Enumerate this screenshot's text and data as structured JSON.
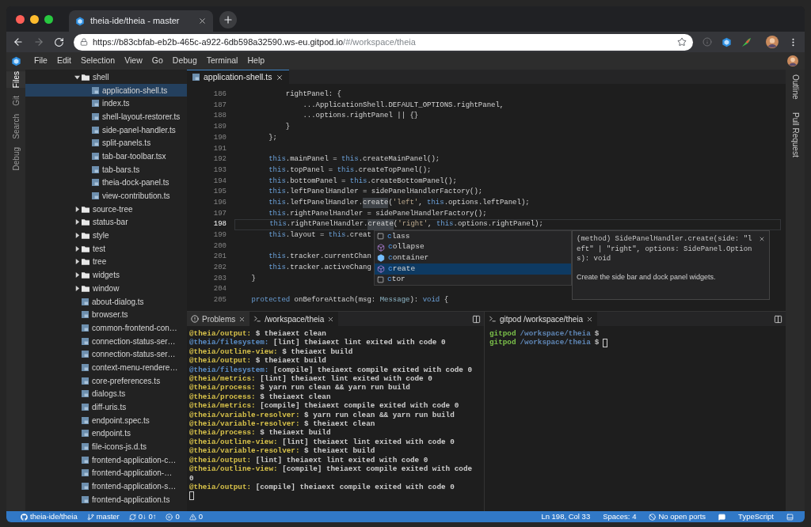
{
  "browser": {
    "tab_title": "theia-ide/theia - master",
    "url_host": "https://b83cbfab-eb2b-465c-a922-6db598a32590.ws-eu.gitpod.io",
    "url_path": "/#/workspace/theia"
  },
  "menu": [
    "File",
    "Edit",
    "Selection",
    "View",
    "Go",
    "Debug",
    "Terminal",
    "Help"
  ],
  "left_tabs": [
    {
      "label": "Files",
      "selected": true
    },
    {
      "label": "Git",
      "selected": false
    },
    {
      "label": "Search",
      "selected": false
    },
    {
      "label": "Debug",
      "selected": false
    }
  ],
  "right_tabs": [
    {
      "label": "Outline",
      "selected": false
    },
    {
      "label": "Pull Request",
      "selected": false
    }
  ],
  "file_tree": [
    {
      "name": "shell",
      "kind": "folder",
      "expanded": true,
      "selected": false,
      "children": [
        {
          "name": "application-shell.ts",
          "kind": "file",
          "selected": true
        },
        {
          "name": "index.ts",
          "kind": "file",
          "selected": false
        },
        {
          "name": "shell-layout-restorer.ts",
          "kind": "file",
          "selected": false
        },
        {
          "name": "side-panel-handler.ts",
          "kind": "file",
          "selected": false
        },
        {
          "name": "split-panels.ts",
          "kind": "file",
          "selected": false
        },
        {
          "name": "tab-bar-toolbar.tsx",
          "kind": "file",
          "selected": false
        },
        {
          "name": "tab-bars.ts",
          "kind": "file",
          "selected": false
        },
        {
          "name": "theia-dock-panel.ts",
          "kind": "file",
          "selected": false
        },
        {
          "name": "view-contribution.ts",
          "kind": "file",
          "selected": false
        }
      ]
    },
    {
      "name": "source-tree",
      "kind": "folder",
      "expanded": false,
      "selected": false
    },
    {
      "name": "status-bar",
      "kind": "folder",
      "expanded": false,
      "selected": false
    },
    {
      "name": "style",
      "kind": "folder",
      "expanded": false,
      "selected": false
    },
    {
      "name": "test",
      "kind": "folder",
      "expanded": false,
      "selected": false
    },
    {
      "name": "tree",
      "kind": "folder",
      "expanded": false,
      "selected": false
    },
    {
      "name": "widgets",
      "kind": "folder",
      "expanded": false,
      "selected": false
    },
    {
      "name": "window",
      "kind": "folder",
      "expanded": false,
      "selected": false
    },
    {
      "name": "about-dialog.ts",
      "kind": "file",
      "selected": false
    },
    {
      "name": "browser.ts",
      "kind": "file",
      "selected": false
    },
    {
      "name": "common-frontend-con…",
      "kind": "file",
      "selected": false
    },
    {
      "name": "connection-status-ser…",
      "kind": "file",
      "selected": false
    },
    {
      "name": "connection-status-ser…",
      "kind": "file",
      "selected": false
    },
    {
      "name": "context-menu-rendere…",
      "kind": "file",
      "selected": false
    },
    {
      "name": "core-preferences.ts",
      "kind": "file",
      "selected": false
    },
    {
      "name": "dialogs.ts",
      "kind": "file",
      "selected": false
    },
    {
      "name": "diff-uris.ts",
      "kind": "file",
      "selected": false
    },
    {
      "name": "endpoint.spec.ts",
      "kind": "file",
      "selected": false
    },
    {
      "name": "endpoint.ts",
      "kind": "file",
      "selected": false
    },
    {
      "name": "file-icons-js.d.ts",
      "kind": "file",
      "selected": false
    },
    {
      "name": "frontend-application-c…",
      "kind": "file",
      "selected": false
    },
    {
      "name": "frontend-application-…",
      "kind": "file",
      "selected": false
    },
    {
      "name": "frontend-application-s…",
      "kind": "file",
      "selected": false
    },
    {
      "name": "frontend-application.ts",
      "kind": "file",
      "selected": false
    }
  ],
  "editor": {
    "tabs": [
      {
        "label": "application-shell.ts",
        "selected": true
      }
    ],
    "lines": [
      {
        "number": "186",
        "current": false,
        "tokens": [
          {
            "text": "            rightPanel: {",
            "kind": "plain"
          }
        ]
      },
      {
        "number": "187",
        "current": false,
        "tokens": [
          {
            "text": "                ...ApplicationShell.DEFAULT_OPTIONS.rightPanel,",
            "kind": "plain"
          }
        ]
      },
      {
        "number": "188",
        "current": false,
        "tokens": [
          {
            "text": "                ...options.rightPanel || {}",
            "kind": "plain"
          }
        ]
      },
      {
        "number": "189",
        "current": false,
        "tokens": [
          {
            "text": "            }",
            "kind": "plain"
          }
        ]
      },
      {
        "number": "190",
        "current": false,
        "tokens": [
          {
            "text": "        };",
            "kind": "plain"
          }
        ]
      },
      {
        "number": "191",
        "current": false
      },
      {
        "number": "192",
        "current": false,
        "tokens": [
          {
            "text": "        this",
            "kind": "keyword"
          },
          {
            "text": ".mainPanel = ",
            "kind": "plain"
          },
          {
            "text": "this",
            "kind": "keyword"
          },
          {
            "text": ".createMainPanel();",
            "kind": "plain"
          }
        ]
      },
      {
        "number": "193",
        "current": false,
        "tokens": [
          {
            "text": "        this",
            "kind": "keyword"
          },
          {
            "text": ".topPanel = ",
            "kind": "plain"
          },
          {
            "text": "this",
            "kind": "keyword"
          },
          {
            "text": ".createTopPanel();",
            "kind": "plain"
          }
        ]
      },
      {
        "number": "194",
        "current": false,
        "tokens": [
          {
            "text": "        this",
            "kind": "keyword"
          },
          {
            "text": ".bottomPanel = ",
            "kind": "plain"
          },
          {
            "text": "this",
            "kind": "keyword"
          },
          {
            "text": ".createBottomPanel();",
            "kind": "plain"
          }
        ]
      },
      {
        "number": "195",
        "current": false,
        "tokens": [
          {
            "text": "        this",
            "kind": "keyword"
          },
          {
            "text": ".leftPanelHandler = sidePanelHandlerFactory();",
            "kind": "plain"
          }
        ]
      },
      {
        "number": "196",
        "current": false,
        "tokens": [
          {
            "text": "        this",
            "kind": "keyword"
          },
          {
            "text": ".leftPanelHandler.",
            "kind": "plain"
          },
          {
            "text": "create",
            "kind": "match"
          },
          {
            "text": "(",
            "kind": "plain"
          },
          {
            "text": "'left'",
            "kind": "string"
          },
          {
            "text": ", ",
            "kind": "plain"
          },
          {
            "text": "this",
            "kind": "keyword"
          },
          {
            "text": ".options.leftPanel);",
            "kind": "plain"
          }
        ]
      },
      {
        "number": "197",
        "current": false,
        "tokens": [
          {
            "text": "        this",
            "kind": "keyword"
          },
          {
            "text": ".rightPanelHandler = sidePanelHandlerFactory();",
            "kind": "plain"
          }
        ]
      },
      {
        "number": "198",
        "current": true,
        "tokens": [
          {
            "text": "        this",
            "kind": "keyword"
          },
          {
            "text": ".rightPanelHandler.",
            "kind": "plain"
          },
          {
            "text": "create",
            "kind": "match"
          },
          {
            "text": "(",
            "kind": "plain"
          },
          {
            "text": "'right'",
            "kind": "string"
          },
          {
            "text": ", ",
            "kind": "plain"
          },
          {
            "text": "this",
            "kind": "keyword"
          },
          {
            "text": ".options.rightPanel);",
            "kind": "plain"
          }
        ]
      },
      {
        "number": "199",
        "current": false,
        "tokens": [
          {
            "text": "        this",
            "kind": "keyword"
          },
          {
            "text": ".layout = ",
            "kind": "plain"
          },
          {
            "text": "this",
            "kind": "keyword"
          },
          {
            "text": ".creat",
            "kind": "plain"
          }
        ]
      },
      {
        "number": "200",
        "current": false
      },
      {
        "number": "201",
        "current": false,
        "tokens": [
          {
            "text": "        this",
            "kind": "keyword"
          },
          {
            "text": ".tracker.currentChan",
            "kind": "plain"
          }
        ]
      },
      {
        "number": "202",
        "current": false,
        "tokens": [
          {
            "text": "        this",
            "kind": "keyword"
          },
          {
            "text": ".tracker.activeChang",
            "kind": "plain"
          }
        ]
      },
      {
        "number": "203",
        "current": false,
        "tokens": [
          {
            "text": "    }",
            "kind": "plain"
          }
        ]
      },
      {
        "number": "204",
        "current": false
      },
      {
        "number": "205",
        "current": false,
        "tokens": [
          {
            "text": "    protected",
            "kind": "keyword"
          },
          {
            "text": " onBeforeAttach(msg: ",
            "kind": "plain"
          },
          {
            "text": "Message",
            "kind": "type"
          },
          {
            "text": "): ",
            "kind": "plain"
          },
          {
            "text": "void",
            "kind": "keyword"
          },
          {
            "text": " {",
            "kind": "plain"
          }
        ]
      }
    ],
    "suggestions": [
      {
        "label": "class",
        "kind": "keyword",
        "selected": false
      },
      {
        "label": "collapse",
        "kind": "method",
        "selected": false
      },
      {
        "label": "container",
        "kind": "field",
        "selected": false
      },
      {
        "label": "create",
        "kind": "method",
        "selected": true
      },
      {
        "label": "ctor",
        "kind": "keyword",
        "selected": false
      }
    ],
    "hover": {
      "signature": "(method) SidePanelHandler.create(side: \"left\" | \"right\", options: SidePanel.Options): void",
      "description": "Create the side bar and dock panel widgets."
    }
  },
  "panels": [
    {
      "tabs": [
        {
          "label": "Problems",
          "kind": "problems",
          "selected": false
        },
        {
          "label": "/workspace/theia",
          "kind": "terminal",
          "selected": true
        }
      ],
      "output": [
        {
          "source": "@theia/output:",
          "color": "#d9c34a",
          "text": " $ theiaext clean"
        },
        {
          "source": "@theia/filesystem:",
          "color": "#5b8fc9",
          "text": " [lint] theiaext lint exited with code 0"
        },
        {
          "source": "@theia/outline-view:",
          "color": "#d9c34a",
          "text": " $ theiaext build"
        },
        {
          "source": "@theia/output:",
          "color": "#d9c34a",
          "text": " $ theiaext build"
        },
        {
          "source": "@theia/filesystem:",
          "color": "#5b8fc9",
          "text": " [compile] theiaext compile exited with code 0"
        },
        {
          "source": "@theia/metrics:",
          "color": "#d9c34a",
          "text": " [lint] theiaext lint exited with code 0"
        },
        {
          "source": "@theia/process:",
          "color": "#d9c34a",
          "text": " $ yarn run clean && yarn run build"
        },
        {
          "source": "@theia/process:",
          "color": "#d9c34a",
          "text": " $ theiaext clean"
        },
        {
          "source": "@theia/metrics:",
          "color": "#d9c34a",
          "text": " [compile] theiaext compile exited with code 0"
        },
        {
          "source": "@theia/variable-resolver:",
          "color": "#d9c34a",
          "text": " $ yarn run clean && yarn run build"
        },
        {
          "source": "@theia/variable-resolver:",
          "color": "#d9c34a",
          "text": " $ theiaext clean"
        },
        {
          "source": "@theia/process:",
          "color": "#d9c34a",
          "text": " $ theiaext build"
        },
        {
          "source": "@theia/outline-view:",
          "color": "#d9c34a",
          "text": " [lint] theiaext lint exited with code 0"
        },
        {
          "source": "@theia/variable-resolver:",
          "color": "#d9c34a",
          "text": " $ theiaext build"
        },
        {
          "source": "@theia/output:",
          "color": "#d9c34a",
          "text": " [lint] theiaext lint exited with code 0"
        },
        {
          "source": "@theia/outline-view:",
          "color": "#d9c34a",
          "text": " [compile] theiaext compile exited with code 0"
        },
        {
          "source": "@theia/output:",
          "color": "#d9c34a",
          "text": " [compile] theiaext compile exited with code 0"
        }
      ]
    },
    {
      "tabs": [
        {
          "label": "gitpod /workspace/theia",
          "kind": "terminal",
          "selected": true
        }
      ],
      "prompts": [
        {
          "user": "gitpod",
          "path": "/workspace/theia",
          "sign": "$",
          "cursor": false
        },
        {
          "user": "gitpod",
          "path": "/workspace/theia",
          "sign": "$",
          "cursor": true
        }
      ]
    }
  ],
  "status_bar": {
    "left": [
      {
        "kind": "repo",
        "text": "theia-ide/theia"
      },
      {
        "kind": "branch",
        "text": "master"
      },
      {
        "kind": "sync",
        "text": "0↓ 0↑"
      },
      {
        "kind": "errors",
        "text": "0"
      },
      {
        "kind": "warnings",
        "text": "0"
      }
    ],
    "right": [
      {
        "kind": "position",
        "text": "Ln 198, Col 33"
      },
      {
        "kind": "indent",
        "text": "Spaces: 4"
      },
      {
        "kind": "ports",
        "text": "No open ports"
      },
      {
        "kind": "chat"
      },
      {
        "kind": "language",
        "text": "TypeScript"
      },
      {
        "kind": "panel"
      }
    ]
  }
}
